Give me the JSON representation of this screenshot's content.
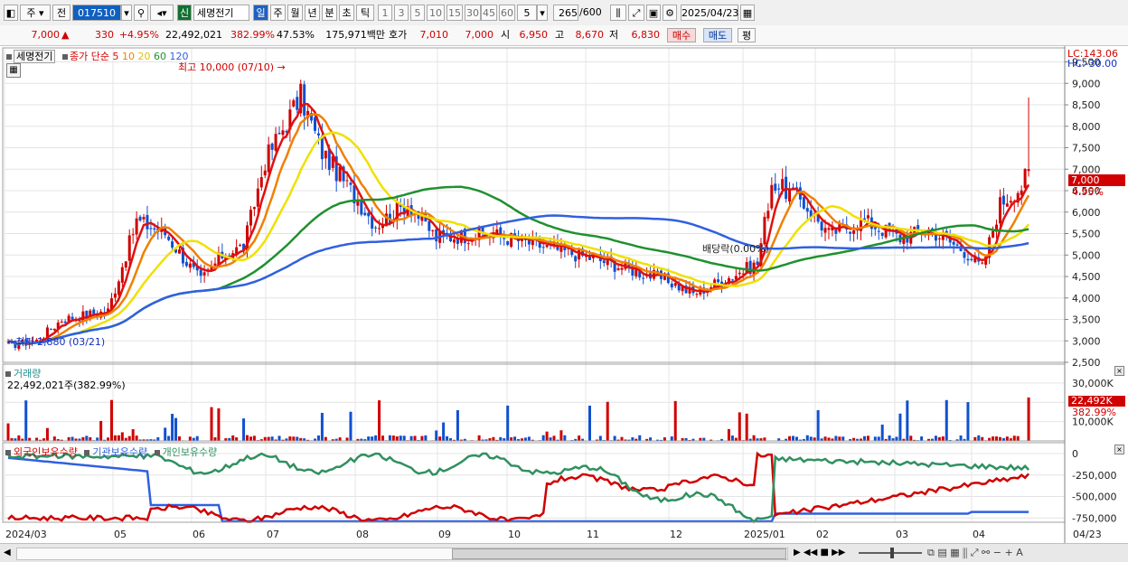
{
  "toolbar": {
    "market": "주",
    "prev_label": "전",
    "code": "017510",
    "new_badge": "신",
    "stock_name": "세명전기",
    "periods": [
      "일",
      "주",
      "월",
      "년",
      "분",
      "초",
      "틱"
    ],
    "nums": [
      "1",
      "3",
      "5",
      "10",
      "15",
      "30",
      "45",
      "60"
    ],
    "interval": "5",
    "count": "265",
    "count_total": "/600",
    "date": "2025/04/23"
  },
  "info": {
    "price": "7,000",
    "change": "330",
    "change_pct": "+4.95%",
    "volume": "22,492,021",
    "vol_ratio": "382.99%",
    "turnover": "47.53%",
    "amount": "175,971백만",
    "quote_label": "호가",
    "quote_bid": "7,010",
    "quote_ask": "7,000",
    "open_label": "시",
    "open": "6,950",
    "high_label": "고",
    "high": "8,670",
    "low_label": "저",
    "low": "6,830",
    "buy_btn": "매수",
    "sell_btn": "매도",
    "eval_btn": "평"
  },
  "chart_legend": {
    "name": "세명전기",
    "ma_label": "종가 단순",
    "ma5": "5",
    "ma10": "10",
    "ma20": "20",
    "ma60": "60",
    "ma120": "120",
    "high_note": "최고 10,000 (07/10)",
    "low_note": "최저 2,880 (03/21)",
    "dividend_note": "배당락(0.00%)",
    "lc": "LC:143.06",
    "hc": "HC:-30.00",
    "price_tag": "7,000",
    "pct_tag": "4.95%"
  },
  "colors": {
    "up": "#d00000",
    "down": "#1050d0",
    "ma5": "#e01010",
    "ma10": "#f08000",
    "ma20": "#f0e000",
    "ma60": "#209030",
    "ma120": "#3060e0",
    "foreign": "#d00000",
    "institution": "#3060e0",
    "individual": "#309060"
  },
  "price_axis": [
    "9,500",
    "9,000",
    "8,500",
    "8,000",
    "7,500",
    "7,000",
    "6,500",
    "6,000",
    "5,500",
    "5,000",
    "4,500",
    "4,000",
    "3,500",
    "3,000",
    "2,500"
  ],
  "volume_panel": {
    "title": "거래량",
    "value": "22,492,021주(382.99%)",
    "axis": [
      "30,000K",
      "20,000K",
      "10,000K"
    ],
    "tag": "22,492K",
    "tag_pct": "382.99%"
  },
  "holdings_panel": {
    "foreign": "외국인보유수량",
    "institution": "기관보유수량",
    "individual": "개인보유수량",
    "axis": [
      "0",
      "-250,000",
      "-500,000",
      "-750,000"
    ]
  },
  "date_axis": [
    "2024/03",
    "05",
    "06",
    "07",
    "08",
    "09",
    "10",
    "11",
    "12",
    "2025/01",
    "02",
    "03",
    "04",
    "04/23"
  ],
  "chart_data": {
    "type": "candlestick",
    "ylim": [
      2500,
      9700
    ],
    "highlights": {
      "high": 10000,
      "high_date": "07/10",
      "low": 2880,
      "low_date": "03/21"
    },
    "anchors": [
      [
        0,
        2900
      ],
      [
        8,
        3000
      ],
      [
        15,
        3500
      ],
      [
        28,
        3700
      ],
      [
        36,
        5800
      ],
      [
        44,
        5500
      ],
      [
        54,
        4400
      ],
      [
        60,
        5000
      ],
      [
        66,
        5200
      ],
      [
        72,
        7200
      ],
      [
        82,
        8700
      ],
      [
        88,
        7400
      ],
      [
        96,
        6500
      ],
      [
        103,
        5700
      ],
      [
        112,
        6200
      ],
      [
        120,
        5400
      ],
      [
        135,
        5500
      ],
      [
        150,
        5200
      ],
      [
        165,
        4900
      ],
      [
        185,
        4400
      ],
      [
        192,
        4100
      ],
      [
        200,
        4400
      ],
      [
        210,
        4800
      ],
      [
        214,
        6700
      ],
      [
        222,
        6300
      ],
      [
        230,
        5500
      ],
      [
        240,
        5800
      ],
      [
        250,
        5400
      ],
      [
        258,
        5600
      ],
      [
        268,
        5100
      ],
      [
        273,
        4700
      ],
      [
        278,
        6200
      ],
      [
        284,
        6600
      ],
      [
        286,
        7000
      ]
    ]
  }
}
